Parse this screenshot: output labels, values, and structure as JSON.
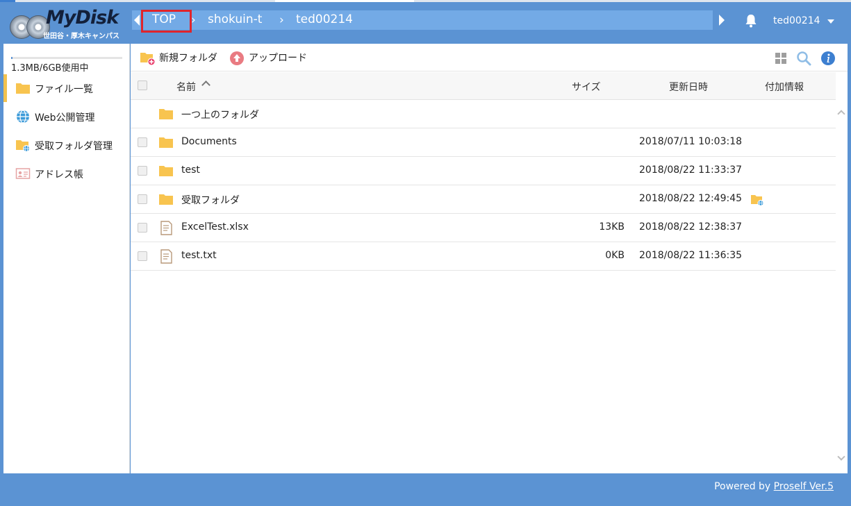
{
  "logo": {
    "title": "MyDisk",
    "subtitle": "世田谷・厚木キャンパス"
  },
  "breadcrumb": {
    "items": [
      "TOP",
      "shokuin-t",
      "ted00214"
    ],
    "separator": "›"
  },
  "header": {
    "user": "ted00214"
  },
  "sidebar": {
    "quota": "1.3MB/6GB使用中",
    "quota_fraction": 0.0002,
    "items": [
      {
        "label": "ファイル一覧",
        "icon": "folder-icon",
        "active": true
      },
      {
        "label": "Web公開管理",
        "icon": "globe-icon",
        "active": false
      },
      {
        "label": "受取フォルダ管理",
        "icon": "receive-folder-icon",
        "active": false
      },
      {
        "label": "アドレス帳",
        "icon": "address-card-icon",
        "active": false
      }
    ]
  },
  "toolbar": {
    "new_folder": "新規フォルダ",
    "upload": "アップロード"
  },
  "table": {
    "columns": {
      "name": "名前",
      "size": "サイズ",
      "updated": "更新日時",
      "extra": "付加情報"
    },
    "parent_row": "一つ上のフォルダ",
    "rows": [
      {
        "name": "Documents",
        "type": "folder",
        "size": "",
        "updated": "2018/07/11 10:03:18",
        "extra": ""
      },
      {
        "name": "test",
        "type": "folder",
        "size": "",
        "updated": "2018/08/22 11:33:37",
        "extra": ""
      },
      {
        "name": "受取フォルダ",
        "type": "folder",
        "size": "",
        "updated": "2018/08/22 12:49:45",
        "extra": "receive-folder-icon"
      },
      {
        "name": "ExcelTest.xlsx",
        "type": "file",
        "size": "13KB",
        "updated": "2018/08/22 12:38:37",
        "extra": ""
      },
      {
        "name": "test.txt",
        "type": "file",
        "size": "0KB",
        "updated": "2018/08/22 11:36:35",
        "extra": ""
      }
    ]
  },
  "footer": {
    "powered_by": "Powered by",
    "product": "Proself Ver.5"
  },
  "colors": {
    "primary": "#5b93d3",
    "breadcrumb_bg": "#73aae6",
    "folder": "#f8c44f",
    "highlight_box": "#e0242b"
  }
}
